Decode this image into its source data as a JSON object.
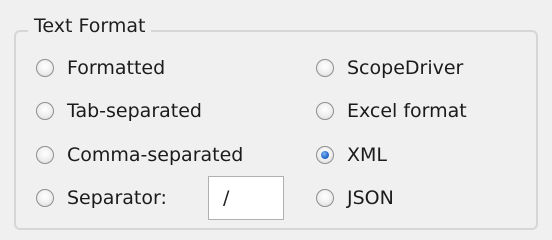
{
  "group": {
    "title": "Text Format"
  },
  "options": {
    "formatted": {
      "label": "Formatted",
      "checked": false
    },
    "tab_separated": {
      "label": "Tab-separated",
      "checked": false
    },
    "comma_separated": {
      "label": "Comma-separated",
      "checked": false
    },
    "separator": {
      "label": "Separator:",
      "checked": false,
      "value": "/"
    },
    "scopedriver": {
      "label": "ScopeDriver",
      "checked": false
    },
    "excel_format": {
      "label": "Excel format",
      "checked": false
    },
    "xml": {
      "label": "XML",
      "checked": true
    },
    "json": {
      "label": "JSON",
      "checked": false
    }
  },
  "colors": {
    "background": "#f0f0f0",
    "group_border": "#d6d6d6",
    "radio_selected": "#2a6fd0"
  }
}
